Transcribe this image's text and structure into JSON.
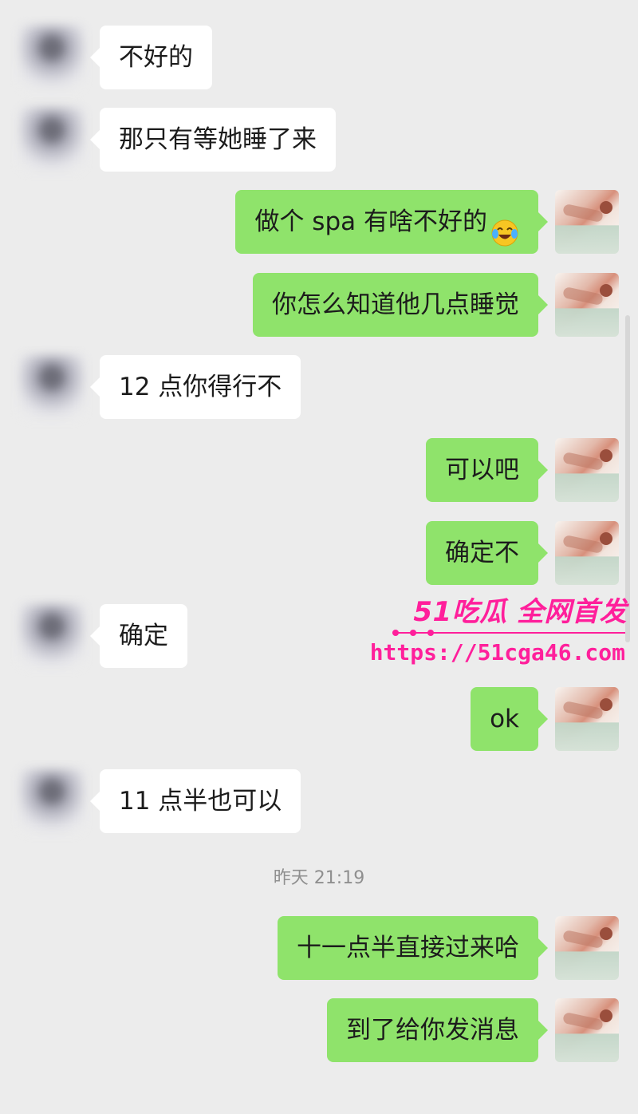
{
  "messages": [
    {
      "text": "不好的",
      "side": "left"
    },
    {
      "text": "那只有等她睡了来",
      "side": "left"
    },
    {
      "text": "做个 spa 有啥不好的",
      "side": "right",
      "emoji": "laughing-crying-emoji"
    },
    {
      "text": "你怎么知道他几点睡觉",
      "side": "right"
    },
    {
      "text": "12 点你得行不",
      "side": "left"
    },
    {
      "text": "可以吧",
      "side": "right"
    },
    {
      "text": "确定不",
      "side": "right"
    },
    {
      "text": "确定",
      "side": "left"
    },
    {
      "text": "ok",
      "side": "right"
    },
    {
      "text": "11 点半也可以",
      "side": "left"
    },
    {
      "text": "十一点半直接过来哈",
      "side": "right"
    },
    {
      "text": "到了给你发消息",
      "side": "right"
    }
  ],
  "timestamp": "昨天 21:19",
  "watermark": {
    "title": "51吃瓜 全网首发",
    "url": "https://51cga46.com"
  },
  "colors": {
    "background": "#ececec",
    "sent_bubble": "#8fe36b",
    "received_bubble": "#ffffff",
    "watermark": "#ff1f9b"
  }
}
